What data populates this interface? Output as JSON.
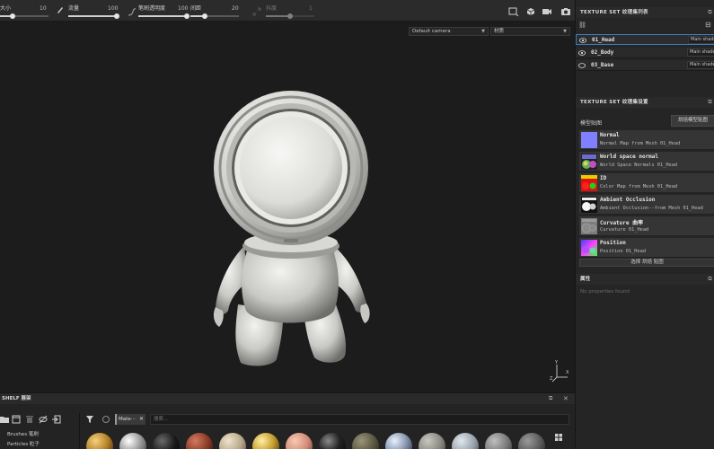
{
  "toolbar": {
    "sliders": [
      {
        "label": "大小",
        "value": "10",
        "fill": 0.25
      },
      {
        "label": "流量",
        "value": "100",
        "fill": 1.0
      },
      {
        "label": "笔刷透明度",
        "value": "100",
        "fill": 1.0
      },
      {
        "label": "间距",
        "value": "20",
        "fill": 0.3
      },
      {
        "label": "抖度",
        "value": "1",
        "fill": 0.5
      }
    ]
  },
  "viewport": {
    "camera_select": "Default camera",
    "channel_select": "材质",
    "axis_labels": {
      "y": "Y",
      "x": "X",
      "z": "Z"
    }
  },
  "texture_set_list": {
    "title": "TEXTURE SET 纹理集列表",
    "items": [
      {
        "name": "01_Head",
        "shader": "Main shader",
        "selected": true
      },
      {
        "name": "02_Body",
        "shader": "Main shader",
        "selected": false
      },
      {
        "name": "03_Base",
        "shader": "Main shader",
        "selected": false
      }
    ]
  },
  "texture_set_settings": {
    "title": "TEXTURE SET 纹理集设置",
    "model_maps_label": "模型贴图",
    "bake_button": "烘焙模型贴图",
    "maps": [
      {
        "title": "Normal",
        "sub": "Normal Map from Mesh 01_Head",
        "icon": "normal-map-icon"
      },
      {
        "title": "World space normal",
        "sub": "World Space Normals 01_Head",
        "icon": "world-normal-map-icon"
      },
      {
        "title": "ID",
        "sub": "Color Map from Mesh 01_Head",
        "icon": "id-map-icon"
      },
      {
        "title": "Ambient Occlusion",
        "sub": "Ambient Occlusion--from Mesh 01_Head",
        "icon": "ao-map-icon"
      },
      {
        "title": "Curvature 曲率",
        "sub": "Curvature 01_Head",
        "icon": "curvature-map-icon"
      },
      {
        "title": "Position",
        "sub": "Position 01_Head",
        "icon": "position-map-icon"
      }
    ],
    "select_maps_button": "选择 烘焙 贴图"
  },
  "properties": {
    "title": "属性",
    "empty_text": "No properties found"
  },
  "shelf": {
    "title": "SHELF 展架",
    "categories": [
      "Brushes 笔刷",
      "Particles 粒子"
    ],
    "filter_tag": "Mate···",
    "search_placeholder": "搜索..."
  },
  "colors": {
    "accent": "#3b7fc4",
    "panel": "#252525",
    "viewport": "#1c1c1c"
  }
}
